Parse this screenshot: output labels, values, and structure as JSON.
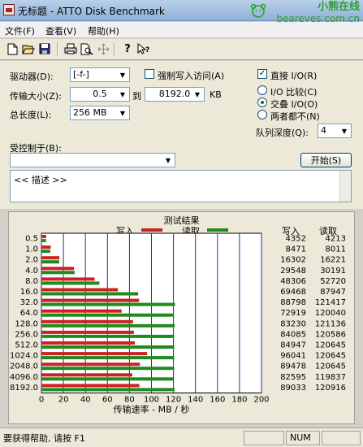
{
  "window": {
    "title": "无标题 - ATTO Disk Benchmark"
  },
  "watermark": {
    "line1": "小熊在线",
    "line2": "beareyes.com.cn"
  },
  "menu": [
    "文件(F)",
    "查看(V)",
    "帮助(H)"
  ],
  "toolbar": {
    "icons": [
      "new-icon",
      "open-icon",
      "save-icon",
      "print-icon",
      "print-preview-icon",
      "move-icon",
      "help-icon",
      "context-help-icon"
    ]
  },
  "form": {
    "drive_label": "驱动器(D):",
    "drive_value": "[-f-]",
    "transfer_label": "传输大小(Z):",
    "transfer_from": "0.5",
    "to_label": "到",
    "transfer_to": "8192.0",
    "kb_label": "KB",
    "length_label": "总长度(L):",
    "length_value": "256 MB",
    "force_write_label": "强制写入访问(A)",
    "force_write_checked": false,
    "direct_io_label": "直接 I/O(R)",
    "direct_io_checked": true,
    "io_compare_label": "I/O 比较(C)",
    "overlap_io_label": "交叠 I/O(O)",
    "neither_label": "两者都不(N)",
    "selected_io": "overlap",
    "queue_label": "队列深度(Q):",
    "queue_value": "4",
    "controlled_by_label": "受控制于(B):",
    "controlled_by_value": "",
    "start_button": "开始(S)",
    "description": "<< 描述 >>"
  },
  "results": {
    "title": "测试结果",
    "write_label": "写入",
    "read_label": "读取",
    "col_write": "写入",
    "col_read": "读取",
    "write_color": "#cc2222",
    "read_color": "#1f8a1f"
  },
  "chart_data": {
    "type": "bar",
    "orientation": "horizontal",
    "title": "测试结果",
    "xlabel": "传输速率 - MB / 秒",
    "xlim": [
      0,
      200
    ],
    "xticks": [
      0,
      20,
      40,
      60,
      80,
      100,
      120,
      140,
      160,
      180,
      200
    ],
    "categories": [
      "0.5",
      "1.0",
      "2.0",
      "4.0",
      "8.0",
      "16.0",
      "32.0",
      "64.0",
      "128.0",
      "256.0",
      "512.0",
      "1024.0",
      "2048.0",
      "4096.0",
      "8192.0"
    ],
    "series": [
      {
        "name": "写入",
        "color": "#cc2222",
        "values": [
          4.35,
          8.47,
          16.3,
          29.55,
          48.31,
          69.47,
          88.8,
          72.92,
          83.23,
          84.09,
          84.95,
          96.04,
          89.48,
          82.6,
          89.03
        ]
      },
      {
        "name": "读取",
        "color": "#1f8a1f",
        "values": [
          4.21,
          8.01,
          16.22,
          30.19,
          52.72,
          87.95,
          121.42,
          120.04,
          121.14,
          120.59,
          120.65,
          120.65,
          120.65,
          119.84,
          120.92
        ]
      }
    ],
    "table_write": [
      "4352",
      "8471",
      "16302",
      "29548",
      "48306",
      "69468",
      "88798",
      "72919",
      "83230",
      "84085",
      "84947",
      "96041",
      "89478",
      "82595",
      "89033"
    ],
    "table_read": [
      "4213",
      "8011",
      "16221",
      "30191",
      "52720",
      "87947",
      "121417",
      "120040",
      "121136",
      "120586",
      "120645",
      "120645",
      "120645",
      "119837",
      "120916"
    ]
  },
  "status": {
    "help_text": "要获得帮助, 请按 F1",
    "num": "NUM"
  }
}
